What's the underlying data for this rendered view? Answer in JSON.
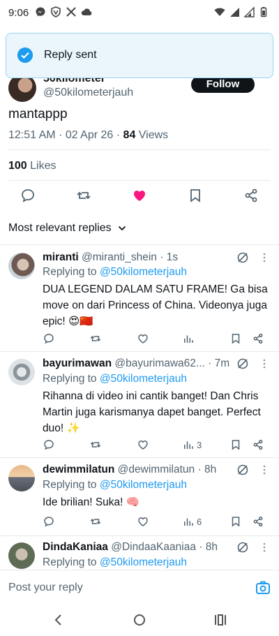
{
  "status_bar": {
    "time": "9:06",
    "left_icons": [
      "messenger-icon",
      "vpn-icon",
      "x-icon",
      "cloud-icon"
    ],
    "right_icons": [
      "wifi-icon",
      "signal-icon",
      "signal-icon-2",
      "battery-icon"
    ]
  },
  "toast": {
    "text": "Reply sent",
    "icon": "check-circle-icon",
    "accent": "#1d9bf0"
  },
  "post": {
    "author_name": "50kilometer",
    "author_handle": "@50kilometerjauh",
    "follow_label": "Follow",
    "text": "mantappp",
    "time_date": "12:51 AM · 02 Apr 26 · ",
    "views_count": "84",
    "views_label": " Views",
    "likes_count": "100",
    "likes_label": " Likes",
    "liked": true,
    "like_color": "#f91880"
  },
  "sort": {
    "label": "Most relevant replies"
  },
  "replies": [
    {
      "name": "miranti",
      "handle": "@miranti_shein",
      "time": " · 1s",
      "replying_prefix": "Replying to ",
      "replying_to": "@50kilometerjauh",
      "text": "DUA LEGEND DALAM SATU FRAME! Ga bisa move on dari Princess of China. Videonya juga epic! 😍🇨🇳",
      "views": ""
    },
    {
      "name": "bayurimawan",
      "handle": "@bayurimawa62...",
      "time": " · 7m",
      "replying_prefix": "Replying to ",
      "replying_to": "@50kilometerjauh",
      "text": "Rihanna di video ini cantik banget! Dan Chris Martin juga karismanya dapet banget. Perfect duo! ✨",
      "views": "3"
    },
    {
      "name": "dewimmilatun",
      "handle": "@dewimmilatun",
      "time": " · 8h",
      "replying_prefix": "Replying to ",
      "replying_to": "@50kilometerjauh",
      "text": "Ide brilian! Suka! 🧠",
      "views": "6"
    },
    {
      "name": "DindaKaniaa",
      "handle": "@DindaaKaaniaa",
      "time": " · 8h",
      "replying_prefix": "Replying to ",
      "replying_to": "@50kilometerjauh",
      "text": "",
      "views": ""
    }
  ],
  "compose": {
    "placeholder": "Post your reply",
    "accent": "#1d9bf0"
  }
}
